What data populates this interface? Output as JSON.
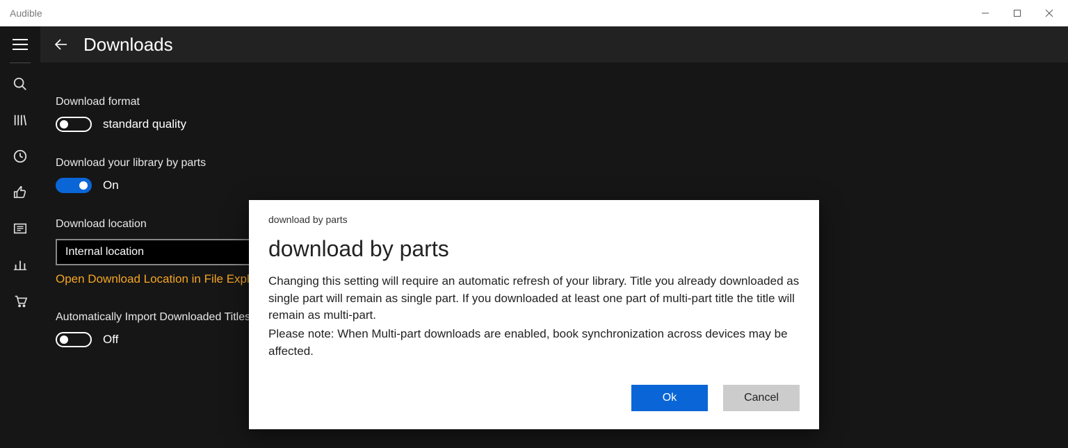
{
  "titlebar": {
    "app_name": "Audible"
  },
  "header": {
    "title": "Downloads"
  },
  "settings": {
    "format_label": "Download format",
    "format_toggle_state": "off",
    "format_value": "standard quality",
    "parts_label": "Download your library by parts",
    "parts_toggle_state": "on",
    "parts_value": "On",
    "location_label": "Download location",
    "location_value": "Internal location",
    "open_link": "Open Download Location in File Explorer",
    "auto_import_label": "Automatically Import Downloaded Titles",
    "auto_import_toggle_state": "off",
    "auto_import_value": "Off"
  },
  "dialog": {
    "small_title": "download by parts",
    "title": "download by parts",
    "body1": "Changing this setting will require an automatic refresh of your library. Title you already downloaded as single part will remain as single part. If you downloaded at least one part of multi-part title the title will remain as multi-part.",
    "body2": "Please note: When Multi-part downloads are enabled, book synchronization across devices may be affected.",
    "ok": "Ok",
    "cancel": "Cancel"
  }
}
